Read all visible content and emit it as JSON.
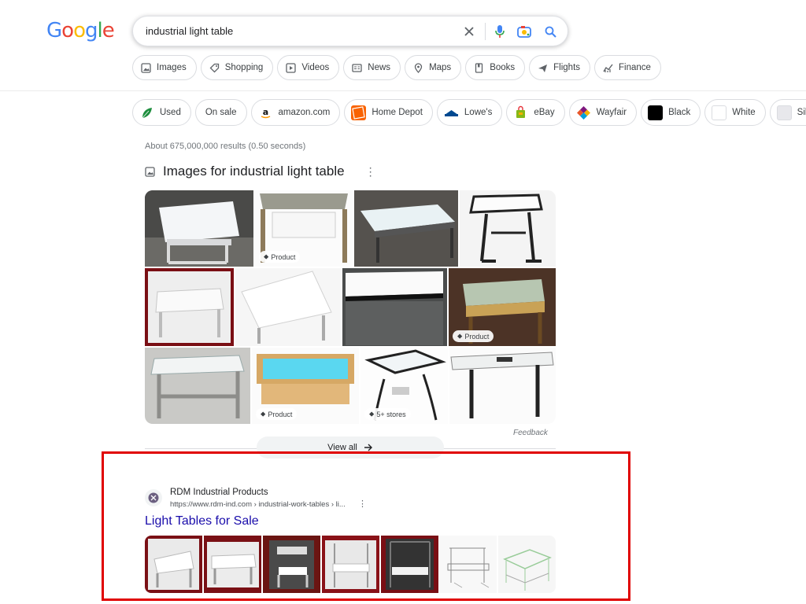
{
  "logo": {
    "letters": [
      "G",
      "o",
      "o",
      "g",
      "l",
      "e"
    ],
    "colors": [
      "#4285F4",
      "#EA4335",
      "#FBBC05",
      "#4285F4",
      "#34A853",
      "#EA4335"
    ]
  },
  "search": {
    "query": "industrial light table",
    "icons": [
      "clear-icon",
      "microphone-icon",
      "lens-camera-icon",
      "search-icon"
    ]
  },
  "tabs": [
    {
      "label": "Images",
      "icon": "image-icon"
    },
    {
      "label": "Shopping",
      "icon": "tag-icon"
    },
    {
      "label": "Videos",
      "icon": "play-icon"
    },
    {
      "label": "News",
      "icon": "news-icon"
    },
    {
      "label": "Maps",
      "icon": "pin-icon"
    },
    {
      "label": "Books",
      "icon": "book-icon"
    },
    {
      "label": "Flights",
      "icon": "plane-icon"
    },
    {
      "label": "Finance",
      "icon": "finance-icon"
    }
  ],
  "chips": [
    {
      "label": "Used",
      "swatch": "leaf"
    },
    {
      "label": "On sale",
      "swatch": ""
    },
    {
      "label": "amazon.com",
      "swatch": "amazon"
    },
    {
      "label": "Home Depot",
      "swatch": "homedepot"
    },
    {
      "label": "Lowe's",
      "swatch": "lowes"
    },
    {
      "label": "eBay",
      "swatch": "ebay"
    },
    {
      "label": "Wayfair",
      "swatch": "wayfair"
    },
    {
      "label": "Black",
      "swatch": "#000000"
    },
    {
      "label": "White",
      "swatch": "#ffffff"
    },
    {
      "label": "Silver",
      "swatch": "#e8e8ec"
    }
  ],
  "stats": "About 675,000,000 results (0.50 seconds)",
  "images_section": {
    "title": "Images for industrial light table",
    "tags": {
      "product": "Product",
      "stores": "5+ stores"
    },
    "feedback": "Feedback",
    "view_all": "View all"
  },
  "result": {
    "site_name": "RDM Industrial Products",
    "url": "https://www.rdm-ind.com › industrial-work-tables › li...",
    "title": "Light Tables for Sale"
  },
  "colors": {
    "highlight_box": "#e00000",
    "link": "#1a0dab"
  }
}
